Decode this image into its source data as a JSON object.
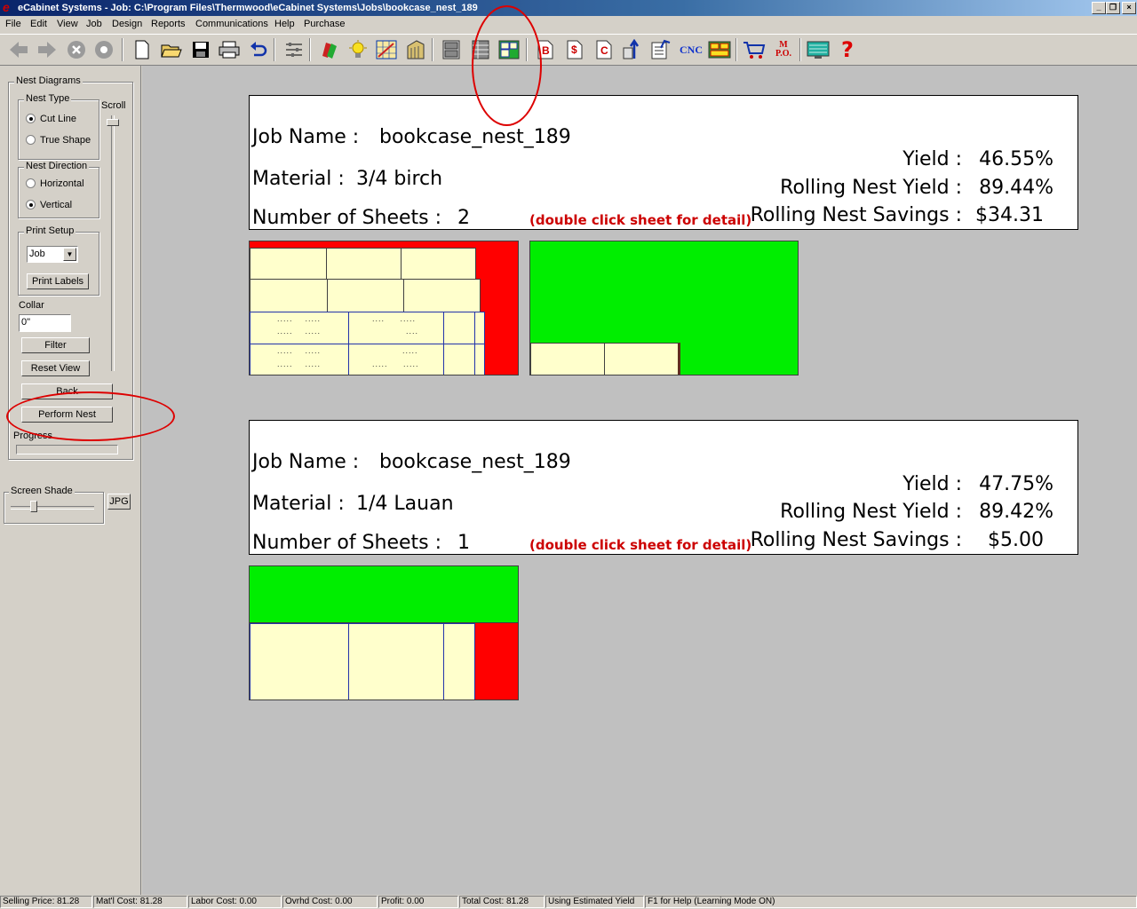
{
  "window": {
    "title": "eCabinet Systems - Job: C:\\Program Files\\Thermwood\\eCabinet Systems\\Jobs\\bookcase_nest_189",
    "app_icon": "e",
    "buttons": [
      "_",
      "❐",
      "×"
    ]
  },
  "menu": {
    "items": [
      "File",
      "Edit",
      "View",
      "Job",
      "Design",
      "Reports",
      "Communications",
      "Help",
      "Purchase"
    ]
  },
  "toolbar": {
    "cnc_label": "CNC",
    "mpo_label": "M P.O.",
    "help_label": "?",
    "b_label": "B",
    "s_label": "$",
    "c_label": "C"
  },
  "left_panel": {
    "nest_diagrams_label": "Nest Diagrams",
    "scroll_label": "Scroll",
    "nest_type": {
      "label": "Nest Type",
      "options": [
        "Cut Line",
        "True Shape"
      ],
      "selected": "Cut Line"
    },
    "nest_direction": {
      "label": "Nest Direction",
      "options": [
        "Horizontal",
        "Vertical"
      ],
      "selected": "Vertical"
    },
    "print_setup": {
      "label": "Print Setup",
      "select_value": "Job",
      "print_labels_button": "Print Labels"
    },
    "collar": {
      "label": "Collar",
      "value": "0\""
    },
    "filter_button": "Filter",
    "reset_view_button": "Reset View",
    "back_button": "Back",
    "perform_nest_button": "Perform Nest",
    "progress_label": "Progress",
    "screen_shade_label": "Screen Shade",
    "jpg_button": "JPG"
  },
  "nests": [
    {
      "job_name_label": "Job Name :",
      "job_name": "bookcase_nest_189",
      "material_label": "Material :",
      "material": "3/4 birch",
      "sheets_label": "Number of Sheets :",
      "sheets": "2",
      "hint": "(double click sheet for detail)",
      "yield_label": "Yield :",
      "yield": "46.55%",
      "rolling_yield_label": "Rolling Nest Yield :",
      "rolling_yield": "89.44%",
      "savings_label": "Rolling Nest Savings :",
      "savings": "$34.31"
    },
    {
      "job_name_label": "Job Name :",
      "job_name": "bookcase_nest_189",
      "material_label": "Material :",
      "material": "1/4 Lauan",
      "sheets_label": "Number of Sheets :",
      "sheets": "1",
      "hint": "(double click sheet for detail)",
      "yield_label": "Yield :",
      "yield": "47.75%",
      "rolling_yield_label": "Rolling Nest Yield :",
      "rolling_yield": "89.42%",
      "savings_label": "Rolling Nest Savings :",
      "savings": "$5.00"
    }
  ],
  "colors": {
    "waste_red": "#ff0000",
    "offcut_green": "#00ee00",
    "part_fill": "#ffffcc",
    "annotation_red": "#dd0000"
  },
  "status_bar": [
    "Selling Price: 81.28",
    "Mat'l Cost: 81.28",
    "Labor Cost: 0.00",
    "Ovrhd Cost: 0.00",
    "Profit: 0.00",
    "Total Cost: 81.28",
    "Using Estimated Yield",
    "F1 for Help (Learning Mode ON)"
  ]
}
